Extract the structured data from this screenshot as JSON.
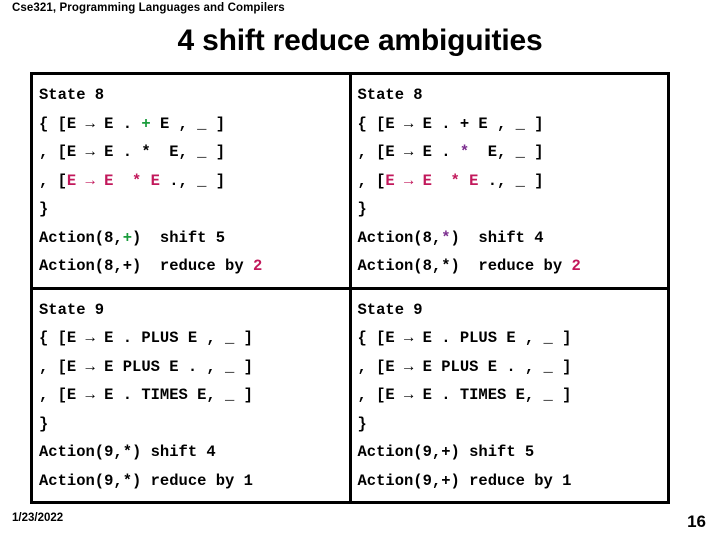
{
  "header": {
    "course": "Cse321, Programming Languages and Compilers",
    "title": "4 shift reduce ambiguities"
  },
  "colors": {
    "green": "#1a9c3c",
    "crimson": "#c2185b",
    "purple": "#7b2d8e",
    "black": "#000000",
    "border": "#000000",
    "background": "#ffffff"
  },
  "footer": {
    "date": "1/23/2022",
    "page": "16"
  },
  "table": {
    "cells": [
      {
        "id": "state-8-plus",
        "state_label": "State 8",
        "lines": [
          {
            "text": "State 8",
            "color": "black"
          },
          {
            "text": "{ [E → E . + E , _ ]",
            "color": "mixed-green-plus"
          },
          {
            "text": ", [E → E . *  E, _ ]",
            "color": "black"
          },
          {
            "text": ", [E → E  * E ., _ ]",
            "color": "crimson-production"
          },
          {
            "text": "}",
            "color": "black"
          },
          {
            "text": "Action(8,+)  shift 5",
            "color": "mixed-green-plus"
          },
          {
            "text": "Action(8,+)  reduce by 2",
            "color": "crimson-number"
          }
        ],
        "action_shift": "Action(8,+)  shift 5",
        "action_reduce": "Action(8,+)  reduce by 2"
      },
      {
        "id": "state-8-times",
        "state_label": "State 8",
        "lines": [
          {
            "text": "State 8",
            "color": "black"
          },
          {
            "text": "{ [E → E . + E , _ ]",
            "color": "black"
          },
          {
            "text": ", [E → E . *  E, _ ]",
            "color": "mixed-purple-star"
          },
          {
            "text": ", [E → E  * E ., _ ]",
            "color": "crimson-production"
          },
          {
            "text": "}",
            "color": "black"
          },
          {
            "text": "Action(8,*)  shift 4",
            "color": "mixed-purple-star"
          },
          {
            "text": "Action(8,*)  reduce by 2",
            "color": "crimson-number"
          }
        ],
        "action_shift": "Action(8,*)  shift 4",
        "action_reduce": "Action(8,*)  reduce by 2"
      },
      {
        "id": "state-9-times",
        "state_label": "State 9",
        "lines": [
          {
            "text": "State 9",
            "color": "black"
          },
          {
            "text": "{ [E → E . PLUS E , _ ]",
            "color": "black"
          },
          {
            "text": ", [E → E PLUS E . , _ ]",
            "color": "black"
          },
          {
            "text": ", [E → E . TIMES E, _ ]",
            "color": "black"
          },
          {
            "text": "}",
            "color": "black"
          },
          {
            "text": "Action(9,*) shift 4",
            "color": "black"
          },
          {
            "text": "Action(9,*) reduce by 1",
            "color": "black"
          }
        ],
        "action_shift": "Action(9,*) shift 4",
        "action_reduce": "Action(9,*) reduce by 1"
      },
      {
        "id": "state-9-plus",
        "state_label": "State 9",
        "lines": [
          {
            "text": "State 9",
            "color": "black"
          },
          {
            "text": "{ [E → E . PLUS E , _ ]",
            "color": "black"
          },
          {
            "text": ", [E → E PLUS E . , _ ]",
            "color": "black"
          },
          {
            "text": ", [E → E . TIMES E, _ ]",
            "color": "black"
          },
          {
            "text": "}",
            "color": "black"
          },
          {
            "text": "Action(9,+) shift 5",
            "color": "black"
          },
          {
            "text": "Action(9,+) reduce by 1",
            "color": "black"
          }
        ],
        "action_shift": "Action(9,+) shift 5",
        "action_reduce": "Action(9,+) reduce by 1"
      }
    ]
  },
  "segments": {
    "cell_0": [
      [
        {
          "t": "State 8",
          "c": "black"
        }
      ],
      [
        {
          "t": "{ [E → E . ",
          "c": "black"
        },
        {
          "t": "+",
          "c": "green"
        },
        {
          "t": " E , _ ]",
          "c": "black"
        }
      ],
      [
        {
          "t": ", [E → E . *  E, _ ]",
          "c": "black"
        }
      ],
      [
        {
          "t": ", [",
          "c": "black"
        },
        {
          "t": "E → E  * E",
          "c": "crimson"
        },
        {
          "t": " ., _ ]",
          "c": "black"
        }
      ],
      [
        {
          "t": "}",
          "c": "black"
        }
      ],
      [
        {
          "t": "Action(8,",
          "c": "black"
        },
        {
          "t": "+",
          "c": "green"
        },
        {
          "t": ")  shift 5",
          "c": "black"
        }
      ],
      [
        {
          "t": "Action(8,+)  reduce by ",
          "c": "black"
        },
        {
          "t": "2",
          "c": "crimson"
        }
      ]
    ],
    "cell_1": [
      [
        {
          "t": "State 8",
          "c": "black"
        }
      ],
      [
        {
          "t": "{ [E → E . + E , _ ]",
          "c": "black"
        }
      ],
      [
        {
          "t": ", [E → E . ",
          "c": "black"
        },
        {
          "t": "*",
          "c": "purple"
        },
        {
          "t": "  E, _ ]",
          "c": "black"
        }
      ],
      [
        {
          "t": ", [",
          "c": "black"
        },
        {
          "t": "E → E  * E",
          "c": "crimson"
        },
        {
          "t": " ., _ ]",
          "c": "black"
        }
      ],
      [
        {
          "t": "}",
          "c": "black"
        }
      ],
      [
        {
          "t": "Action(8,",
          "c": "black"
        },
        {
          "t": "*",
          "c": "purple"
        },
        {
          "t": ")  shift 4",
          "c": "black"
        }
      ],
      [
        {
          "t": "Action(8,*)  reduce by ",
          "c": "black"
        },
        {
          "t": "2",
          "c": "crimson"
        }
      ]
    ],
    "cell_2": [
      [
        {
          "t": "State 9",
          "c": "black"
        }
      ],
      [
        {
          "t": "{ [E → E . PLUS E , _ ]",
          "c": "black"
        }
      ],
      [
        {
          "t": ", [E → E PLUS E . , _ ]",
          "c": "black"
        }
      ],
      [
        {
          "t": ", [E → E . TIMES E, _ ]",
          "c": "black"
        }
      ],
      [
        {
          "t": "}",
          "c": "black"
        }
      ],
      [
        {
          "t": "Action(9,*) shift 4",
          "c": "black"
        }
      ],
      [
        {
          "t": "Action(9,*) reduce by 1",
          "c": "black"
        }
      ]
    ],
    "cell_3": [
      [
        {
          "t": "State 9",
          "c": "black"
        }
      ],
      [
        {
          "t": "{ [E → E . PLUS E , _ ]",
          "c": "black"
        }
      ],
      [
        {
          "t": ", [E → E PLUS E . , _ ]",
          "c": "black"
        }
      ],
      [
        {
          "t": ", [E → E . TIMES E, _ ]",
          "c": "black"
        }
      ],
      [
        {
          "t": "}",
          "c": "black"
        }
      ],
      [
        {
          "t": "Action(9,+) shift 5",
          "c": "black"
        }
      ],
      [
        {
          "t": "Action(9,+) reduce by 1",
          "c": "black"
        }
      ]
    ]
  }
}
